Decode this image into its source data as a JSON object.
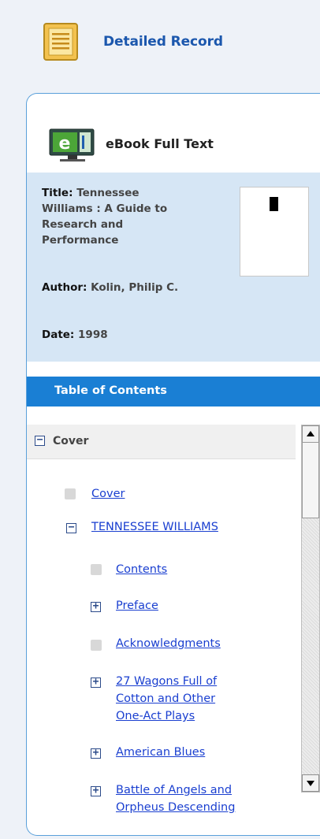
{
  "header": {
    "label": "Detailed Record",
    "icon": "detailed-record-icon"
  },
  "ebook": {
    "label": "eBook Full Text",
    "icon": "ebook-icon"
  },
  "record": {
    "title_label": "Title:",
    "title_line1": "Tennessee",
    "title_line2": "Williams : A Guide to",
    "title_line3": "Research and",
    "title_line4": "Performance",
    "author_label": "Author:",
    "author_value": "Kolin, Philip C.",
    "date_label": "Date:",
    "date_value": "1998"
  },
  "toc": {
    "header": "Table of Contents",
    "root": "Cover",
    "items": {
      "cover": "Cover",
      "tennessee": "TENNESSEE WILLIAMS",
      "contents": "Contents",
      "preface": "Preface",
      "acknowledgments": "Acknowledgments",
      "wagons_1": "27 Wagons Full of",
      "wagons_2": "Cotton and Other",
      "wagons_3": "One-Act Plays",
      "american_blues": "American Blues",
      "battle_1": "Battle of Angels and",
      "battle_2": "Orpheus Descending"
    },
    "toggle_minus": "−",
    "toggle_plus": "+"
  },
  "colors": {
    "accent": "#1a7fd4",
    "link": "#1a3fd0",
    "panel_meta_bg": "#d6e6f5",
    "page_bg": "#eef2f8"
  }
}
